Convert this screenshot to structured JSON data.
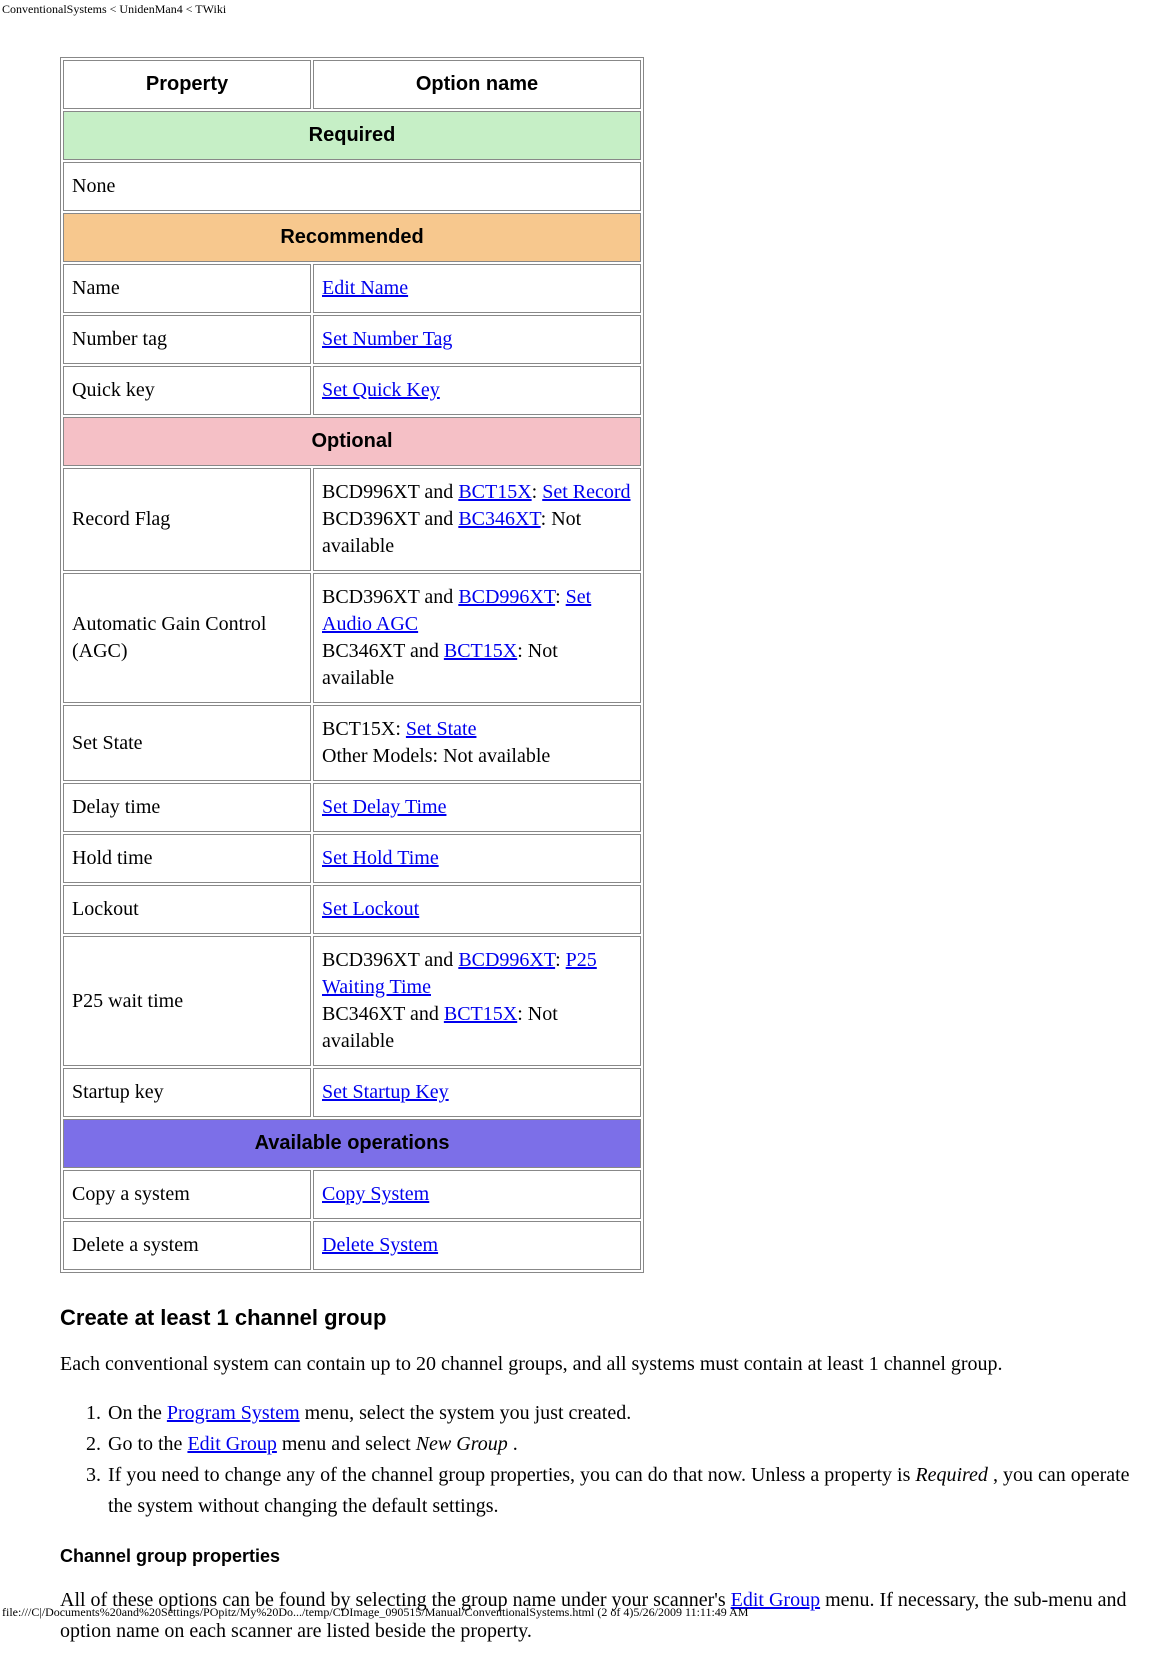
{
  "breadcrumb": "ConventionalSystems < UnidenMan4 < TWiki",
  "table": {
    "header": {
      "property": "Property",
      "option": "Option name"
    },
    "sections": {
      "required": "Required",
      "recommended": "Recommended",
      "optional": "Optional",
      "ops": "Available operations"
    },
    "required_none": "None",
    "recommended": [
      {
        "prop": "Name",
        "link": "Edit Name"
      },
      {
        "prop": "Number tag",
        "link": "Set Number Tag"
      },
      {
        "prop": "Quick key",
        "link": "Set Quick Key"
      }
    ],
    "optional": {
      "record_flag": {
        "prop": "Record Flag",
        "pre1": "BCD996XT and ",
        "l1": "BCT15X",
        "mid1": ": ",
        "l2": "Set Record",
        "pre2": "BCD396XT and ",
        "l3": "BC346XT",
        "suf2": ": Not available"
      },
      "agc": {
        "prop": "Automatic Gain Control (AGC)",
        "pre1": "BCD396XT and ",
        "l1": "BCD996XT",
        "mid1": ": ",
        "l2": "Set Audio AGC",
        "pre2": "BC346XT and ",
        "l3": "BCT15X",
        "suf2": ": Not available"
      },
      "state": {
        "prop": "Set State",
        "pre1": "BCT15X: ",
        "l1": "Set State",
        "line2": "Other Models: Not available"
      },
      "delay": {
        "prop": "Delay time",
        "link": "Set Delay Time"
      },
      "hold": {
        "prop": "Hold time",
        "link": "Set Hold Time"
      },
      "lockout": {
        "prop": "Lockout",
        "link": "Set Lockout"
      },
      "p25": {
        "prop": "P25 wait time",
        "pre1": "BCD396XT and ",
        "l1": "BCD996XT",
        "mid1": ": ",
        "l2": "P25 Waiting Time",
        "pre2": "BC346XT and ",
        "l3": "BCT15X",
        "suf2": ": Not available"
      },
      "startup": {
        "prop": "Startup key",
        "link": "Set Startup Key"
      }
    },
    "ops": [
      {
        "prop": "Copy a system",
        "link": "Copy System"
      },
      {
        "prop": "Delete a system",
        "link": "Delete System"
      }
    ]
  },
  "h2": "Create at least 1 channel group",
  "p1": "Each conventional system can contain up to 20 channel groups, and all systems must contain at least 1 channel group.",
  "steps": {
    "s1a": "On the ",
    "s1l": "Program System",
    "s1b": " menu, select the system you just created.",
    "s2a": "Go to the ",
    "s2l": "Edit Group",
    "s2b": " menu and select ",
    "s2i": "New Group",
    "s2c": " .",
    "s3a": "If you need to change any of the channel group properties, you can do that now. Unless a property is ",
    "s3i": "Required",
    "s3b": " , you can operate the system without changing the default settings."
  },
  "h3": "Channel group properties",
  "p2a": "All of these options can be found by selecting the group name under your scanner's ",
  "p2l": "Edit Group",
  "p2b": " menu. If necessary, the sub-menu and option name on each scanner are listed beside the property.",
  "footer": "file:///C|/Documents%20and%20Settings/POpitz/My%20Do.../temp/CDImage_090515/Manual/ConventionalSystems.html (2 of 4)5/26/2009 11:11:49 AM"
}
